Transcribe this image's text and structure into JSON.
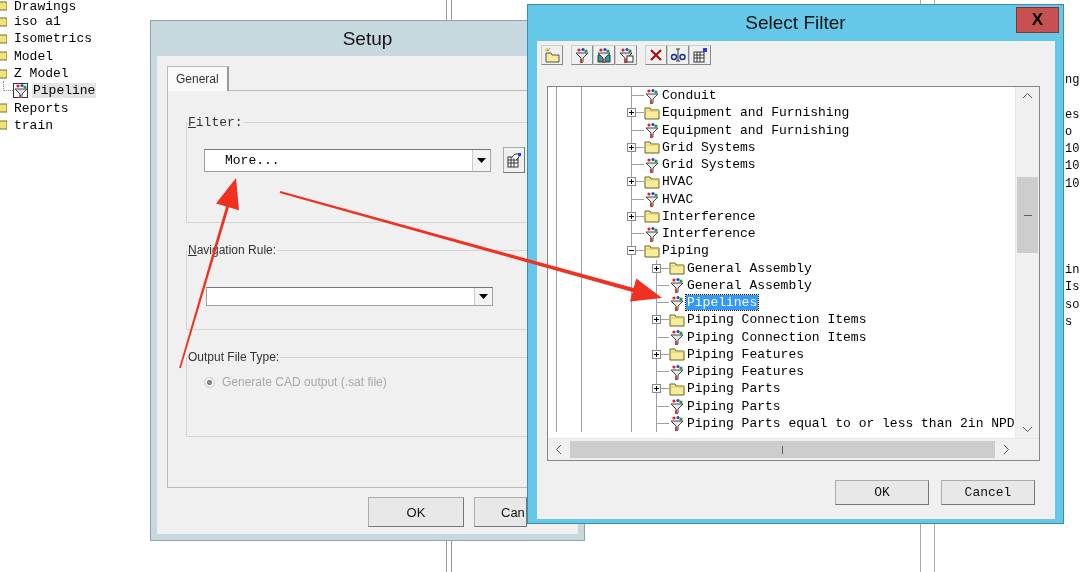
{
  "left_tree": {
    "items": [
      {
        "label": "Drawings",
        "kind": "folder",
        "selected": false
      },
      {
        "label": "iso a1",
        "kind": "folder",
        "selected": false
      },
      {
        "label": "Isometrics",
        "kind": "folder",
        "selected": false
      },
      {
        "label": "Model",
        "kind": "folder",
        "selected": false
      },
      {
        "label": "Z Model",
        "kind": "folder",
        "selected": false,
        "children": [
          {
            "label": "Pipeline",
            "kind": "filter",
            "selected": true
          }
        ]
      },
      {
        "label": "Reports",
        "kind": "folder",
        "selected": false
      },
      {
        "label": "train",
        "kind": "folder",
        "selected": false
      }
    ]
  },
  "background_text": [
    [
      "ng"
    ],
    [
      "es",
      "o",
      "10",
      "10",
      "10"
    ],
    [
      "in",
      "Is",
      "so",
      "s"
    ]
  ],
  "setup_dialog": {
    "title": "Setup",
    "tabs": [
      {
        "label": "General",
        "selected": true
      }
    ],
    "groups": [
      {
        "kind": "combo",
        "label": "Filter:",
        "mnemonic": true,
        "value": "More..."
      },
      {
        "kind": "combo",
        "label": "Navigation Rule:",
        "mnemonic": true
      },
      {
        "kind": "radio",
        "label": "Output File Type:",
        "mnemonic": false,
        "options": [
          {
            "label": "Generate CAD output (.sat file)",
            "selected": true,
            "disabled": true
          }
        ]
      }
    ],
    "buttons": [
      "OK",
      "Can"
    ]
  },
  "select_filter": {
    "title": "Select Filter",
    "close": "X",
    "tree": [
      {
        "label": "Conduit",
        "kind": "filter",
        "selected": false
      },
      {
        "label": "Equipment and Furnishing",
        "kind": "folder",
        "expanded": false,
        "selected": false
      },
      {
        "label": "Equipment and Furnishing",
        "kind": "filter",
        "selected": false
      },
      {
        "label": "Grid Systems",
        "kind": "folder",
        "expanded": false,
        "selected": false
      },
      {
        "label": "Grid Systems",
        "kind": "filter",
        "selected": false
      },
      {
        "label": "HVAC",
        "kind": "folder",
        "expanded": false,
        "selected": false
      },
      {
        "label": "HVAC",
        "kind": "filter",
        "selected": false
      },
      {
        "label": "Interference",
        "kind": "folder",
        "expanded": false,
        "selected": false
      },
      {
        "label": "Interference",
        "kind": "filter",
        "selected": false
      },
      {
        "label": "Piping",
        "kind": "folder",
        "expanded": true,
        "selected": false,
        "children": [
          {
            "label": "General Assembly",
            "kind": "folder",
            "expanded": false,
            "selected": false
          },
          {
            "label": "General Assembly",
            "kind": "filter",
            "selected": false
          },
          {
            "label": "Pipelines",
            "kind": "filter",
            "selected": true
          },
          {
            "label": "Piping Connection Items",
            "kind": "folder",
            "expanded": false,
            "selected": false
          },
          {
            "label": "Piping Connection Items",
            "kind": "filter",
            "selected": false
          },
          {
            "label": "Piping Features",
            "kind": "folder",
            "expanded": false,
            "selected": false
          },
          {
            "label": "Piping Features",
            "kind": "filter",
            "selected": false
          },
          {
            "label": "Piping Parts",
            "kind": "folder",
            "expanded": false,
            "selected": false
          },
          {
            "label": "Piping Parts",
            "kind": "filter",
            "selected": false
          },
          {
            "label": "Piping Parts equal to or less than 2in NPD",
            "kind": "filter",
            "selected": false
          }
        ]
      }
    ],
    "buttons": [
      "OK",
      "Cancel"
    ]
  }
}
